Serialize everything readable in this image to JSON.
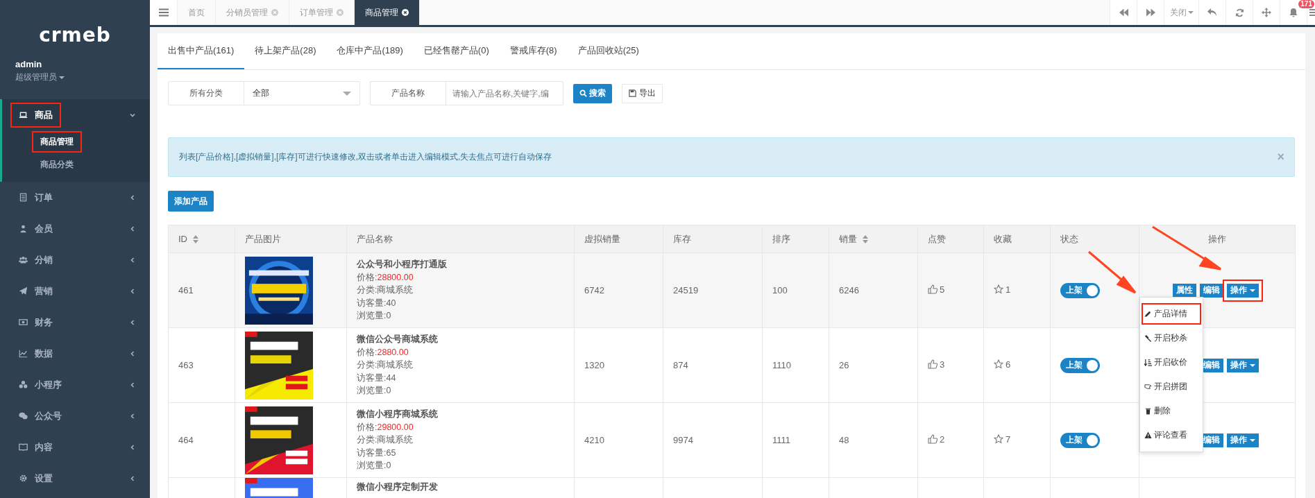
{
  "sidebar": {
    "logo": "crmeb",
    "user": {
      "name": "admin",
      "role": "超级管理员"
    },
    "menu": [
      {
        "label": "商品",
        "expanded": true,
        "highlighted": true,
        "children": [
          {
            "label": "商品管理",
            "selected": true,
            "highlighted": true
          },
          {
            "label": "商品分类",
            "selected": false,
            "highlighted": false
          }
        ]
      },
      {
        "label": "订单",
        "expanded": false,
        "highlighted": false
      },
      {
        "label": "会员",
        "expanded": false,
        "highlighted": false
      },
      {
        "label": "分销",
        "expanded": false,
        "highlighted": false
      },
      {
        "label": "营销",
        "expanded": false,
        "highlighted": false
      },
      {
        "label": "财务",
        "expanded": false,
        "highlighted": false
      },
      {
        "label": "数据",
        "expanded": false,
        "highlighted": false
      },
      {
        "label": "小程序",
        "expanded": false,
        "highlighted": false
      },
      {
        "label": "公众号",
        "expanded": false,
        "highlighted": false
      },
      {
        "label": "内容",
        "expanded": false,
        "highlighted": false
      },
      {
        "label": "设置",
        "expanded": false,
        "highlighted": false
      }
    ]
  },
  "page_tabs": [
    {
      "label": "首页",
      "closable": false,
      "selected": false
    },
    {
      "label": "分销员管理",
      "closable": true,
      "selected": false
    },
    {
      "label": "订单管理",
      "closable": true,
      "selected": false
    },
    {
      "label": "商品管理",
      "closable": true,
      "selected": true
    }
  ],
  "toolbar": {
    "close_menu": "关闭",
    "notification_badge": "171"
  },
  "product_tabs": [
    {
      "label": "出售中产品(161)",
      "selected": true
    },
    {
      "label": "待上架产品(28)",
      "selected": false
    },
    {
      "label": "仓库中产品(189)",
      "selected": false
    },
    {
      "label": "已经售罄产品(0)",
      "selected": false
    },
    {
      "label": "警戒库存(8)",
      "selected": false
    },
    {
      "label": "产品回收站(25)",
      "selected": false
    }
  ],
  "filters": {
    "category_label": "所有分类",
    "category_value": "全部",
    "name_label": "产品名称",
    "name_placeholder": "请输入产品名称,关键字,编",
    "search_button": "搜索",
    "export_button": "导出"
  },
  "alert": {
    "text": "列表[产品价格],[虚拟销量],[库存]可进行快速修改,双击或者单击进入编辑模式,失去焦点可进行自动保存",
    "close": "×"
  },
  "add_button": "添加产品",
  "table": {
    "columns": [
      {
        "label": "ID",
        "sortable": true
      },
      {
        "label": "产品图片",
        "sortable": false
      },
      {
        "label": "产品名称",
        "sortable": false
      },
      {
        "label": "虚拟销量",
        "sortable": false
      },
      {
        "label": "库存",
        "sortable": false
      },
      {
        "label": "排序",
        "sortable": false
      },
      {
        "label": "销量",
        "sortable": true
      },
      {
        "label": "点赞",
        "sortable": false
      },
      {
        "label": "收藏",
        "sortable": false
      },
      {
        "label": "状态",
        "sortable": false
      },
      {
        "label": "操作",
        "sortable": false
      }
    ],
    "rows": [
      {
        "id": "461",
        "name": "公众号和小程序打通版",
        "price_label": "价格:",
        "price": "28800.00",
        "category": "分类:商城系统",
        "visitors": "访客量:40",
        "views": "浏览量:0",
        "virtual_sales": "6742",
        "stock": "24519",
        "sort": "100",
        "sales": "6246",
        "likes": "5",
        "favorites": "1",
        "status": {
          "label": "上架",
          "on": true
        },
        "actions": [
          {
            "label": "属性",
            "highlighted": false,
            "dropdown": false
          },
          {
            "label": "编辑",
            "highlighted": false,
            "dropdown": false
          },
          {
            "label": "操作",
            "highlighted": true,
            "dropdown": true
          }
        ]
      },
      {
        "id": "463",
        "name": "微信公众号商城系统",
        "price_label": "价格:",
        "price": "2880.00",
        "category": "分类:商城系统",
        "visitors": "访客量:44",
        "views": "浏览量:0",
        "virtual_sales": "1320",
        "stock": "874",
        "sort": "1110",
        "sales": "26",
        "likes": "3",
        "favorites": "6",
        "status": {
          "label": "上架",
          "on": true
        },
        "actions": [
          {
            "label": "编辑",
            "highlighted": false,
            "dropdown": false
          },
          {
            "label": "操作",
            "highlighted": false,
            "dropdown": true
          }
        ]
      },
      {
        "id": "464",
        "name": "微信小程序商城系统",
        "price_label": "价格:",
        "price": "29800.00",
        "category": "分类:商城系统",
        "visitors": "访客量:65",
        "views": "浏览量:0",
        "virtual_sales": "4210",
        "stock": "9974",
        "sort": "1111",
        "sales": "48",
        "likes": "2",
        "favorites": "7",
        "status": {
          "label": "上架",
          "on": true
        },
        "actions": [
          {
            "label": "编辑",
            "highlighted": false,
            "dropdown": false
          },
          {
            "label": "操作",
            "highlighted": false,
            "dropdown": true
          }
        ]
      },
      {
        "name": "微信小程序定制开发"
      }
    ]
  },
  "dropdown_menu": [
    {
      "label": "产品详情",
      "highlighted": true
    },
    {
      "label": "开启秒杀",
      "highlighted": false
    },
    {
      "label": "开启砍价",
      "highlighted": false
    },
    {
      "label": "开启拼团",
      "highlighted": false
    },
    {
      "label": "删除",
      "highlighted": false
    },
    {
      "label": "评论查看",
      "highlighted": false
    }
  ]
}
